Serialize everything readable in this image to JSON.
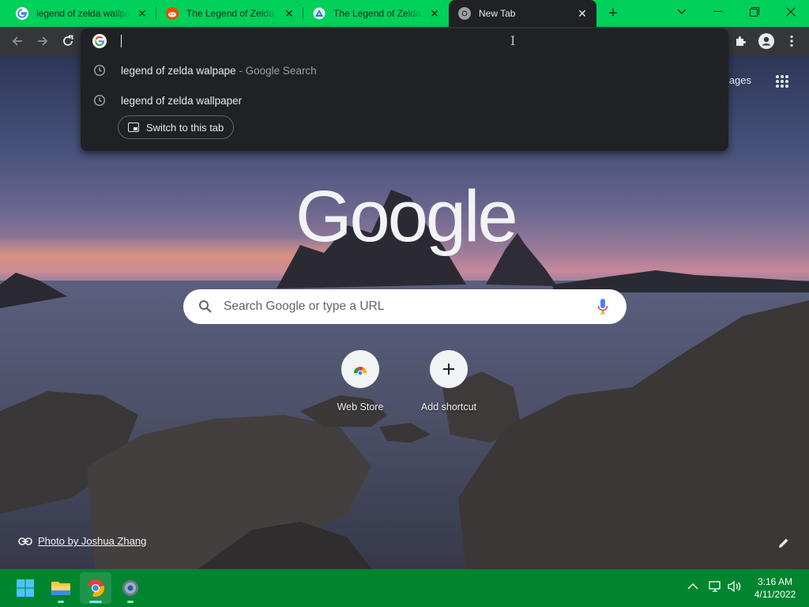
{
  "browser": {
    "tabs": [
      {
        "title": "legend of zelda wallpape",
        "favicon": "google-icon",
        "active": false
      },
      {
        "title": "The Legend of Zelda W",
        "favicon": "reddit-icon",
        "active": false
      },
      {
        "title": "The Legend of Zelda W",
        "favicon": "zelda-site-icon",
        "active": false
      },
      {
        "title": "New Tab",
        "favicon": "chrome-icon",
        "active": true
      }
    ],
    "tab_strip_color": "#00d15a",
    "toolbar_color": "#35363a"
  },
  "omnibox": {
    "input_value": "",
    "suggestions": [
      {
        "text": "legend of zelda walpape",
        "suffix": "- Google Search",
        "icon": "history-clock-icon"
      },
      {
        "text": "legend of zelda wallpaper",
        "suffix": "",
        "icon": "history-clock-icon"
      }
    ],
    "switch_button_label": "Switch to this tab"
  },
  "ntp": {
    "images_link": "mages",
    "logo_text": "Google",
    "search_placeholder": "Search Google or type a URL",
    "shortcuts": [
      {
        "label": "Web Store",
        "icon": "web-store-icon"
      },
      {
        "label": "Add shortcut",
        "icon": "plus-icon"
      }
    ],
    "photo_credit": "Photo by Joshua Zhang"
  },
  "taskbar": {
    "apps": [
      "windows-start-icon",
      "file-explorer-icon",
      "chrome-icon",
      "settings-icon"
    ],
    "time": "3:16 AM",
    "date": "4/11/2022",
    "color": "#00852f"
  }
}
